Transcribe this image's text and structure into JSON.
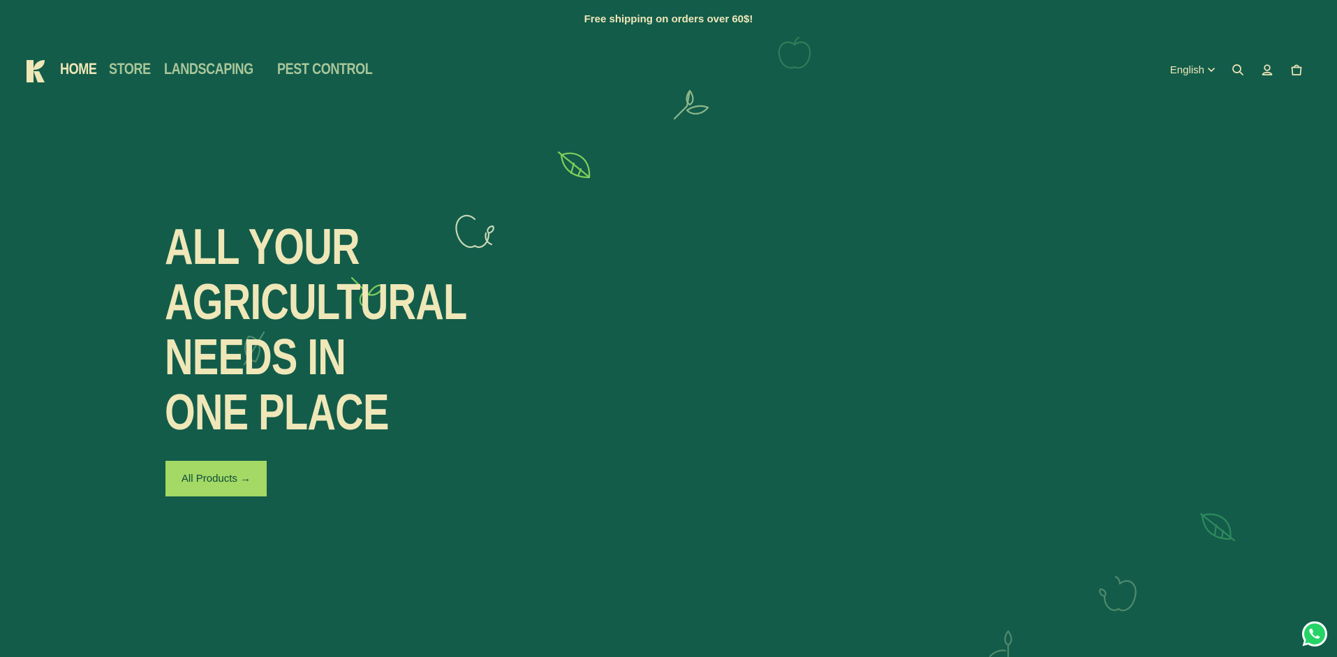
{
  "announcement": {
    "text": "Free shipping on orders over 60$!"
  },
  "header": {
    "logo_icon": "leaf-k-logo-icon",
    "nav": [
      {
        "label": "HOME",
        "active": true
      },
      {
        "label": "STORE",
        "active": false
      },
      {
        "label": "LANDSCAPING",
        "active": false
      },
      {
        "label": "PEST CONTROL",
        "active": false
      }
    ],
    "language": "English",
    "icons": [
      "search-icon",
      "account-icon",
      "cart-icon"
    ]
  },
  "hero": {
    "title_lines": [
      "ALL YOUR",
      "AGRICULTURAL",
      "NEEDS IN",
      "ONE PLACE"
    ],
    "cta_label": "All Products →"
  },
  "floating_widget": {
    "icon": "whatsapp-icon"
  },
  "colors": {
    "background": "#135c4a",
    "cream": "#efe7b8",
    "accent": "#a3d964",
    "nav_inactive": "#a9c69a"
  }
}
